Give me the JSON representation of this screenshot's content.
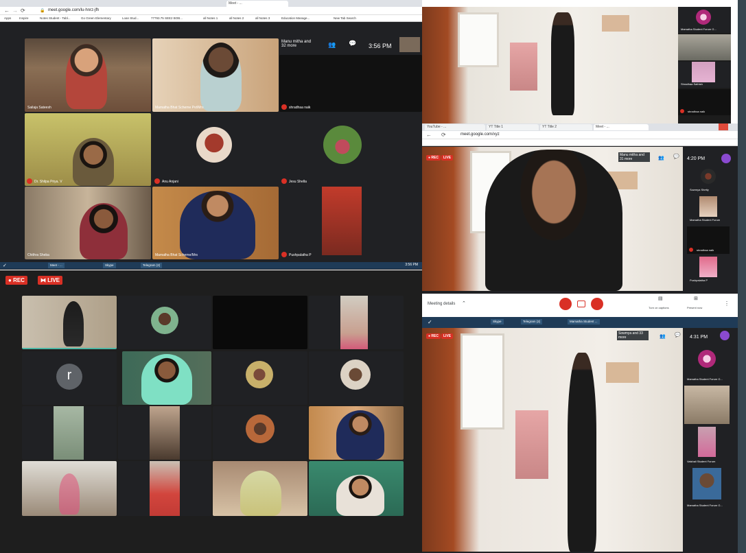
{
  "top_left": {
    "url": "meet.google.com/lu-hnrz-jfh",
    "tabs": [
      "Meet - ..."
    ],
    "bookmarks": [
      "Apps",
      "Inspire",
      "Notes Student - Tabl...",
      "Go Green Elementary",
      "Loan Stud...",
      "77793.75 SEE2 BOB...",
      "all Notes 1",
      "all Notes 2",
      "all Notes 3",
      "Education Manage...",
      "New Tab Search"
    ],
    "meeting_info": "Manu mitha and 32 more",
    "clock": "3:56 PM",
    "tiles": [
      {
        "name": "Sailaja Sateesh"
      },
      {
        "name": "Mamatha Bhat Scheme Pvt/Mrs"
      },
      {
        "name": "shradhaa naik"
      },
      {
        "name": "Dr. Shilpa Priya. V"
      },
      {
        "name": "Anu Anjani"
      },
      {
        "name": "Jesu Shella"
      },
      {
        "name": "Chithra Sheba"
      },
      {
        "name": "Mamatha Bhat Scheme/Mrs"
      },
      {
        "name": "Pushpalatha P"
      }
    ],
    "taskbar": {
      "items": [
        "Meet - ...",
        "Skype",
        "Telegram (2)"
      ],
      "time": "3:56 PM"
    }
  },
  "bottom_left": {
    "rec_label": "REC",
    "live_label": "LIVE",
    "avatar_letter": "r"
  },
  "top_right": {
    "side_names": [
      "Mamatha Student Forum G...",
      "",
      "Shradhaa Sathish",
      "shradhaa naik"
    ]
  },
  "middle_right": {
    "url": "meet.google.com/xyz",
    "tabs": [
      "YouTube - ...",
      "YT Title 1",
      "YT Title 2",
      "Meet - ..."
    ],
    "rec_label": "REC",
    "live_label": "LIVE",
    "meeting_info": "Manu mitha and 31 more",
    "clock": "4:20 PM",
    "side_names": [
      "Sowmya Shetty",
      "Mamatha Student Forum",
      "shradhaa naik",
      "Pushpalatha P"
    ],
    "bottom_bar": {
      "meeting_details": "Meeting details",
      "turn_on_captions": "Turn on captions",
      "present_now": "Present now"
    }
  },
  "bottom_right": {
    "rec_label": "REC",
    "live_label": "LIVE",
    "meeting_info": "Sowmya and 33 more",
    "clock": "4:31 PM",
    "side_names": [
      "Mamatha Student Forum G...",
      "",
      "Vaishali Student Forum",
      "Mamatha Student Forum G..."
    ],
    "taskbar_items": [
      "Skype",
      "Telegram (2)",
      "Mamatha Student ..."
    ]
  },
  "colors": {
    "meet_bg": "#202124",
    "rec_red": "#d93025",
    "taskbar": "#1f3b57",
    "right_edge": "#36454f"
  }
}
